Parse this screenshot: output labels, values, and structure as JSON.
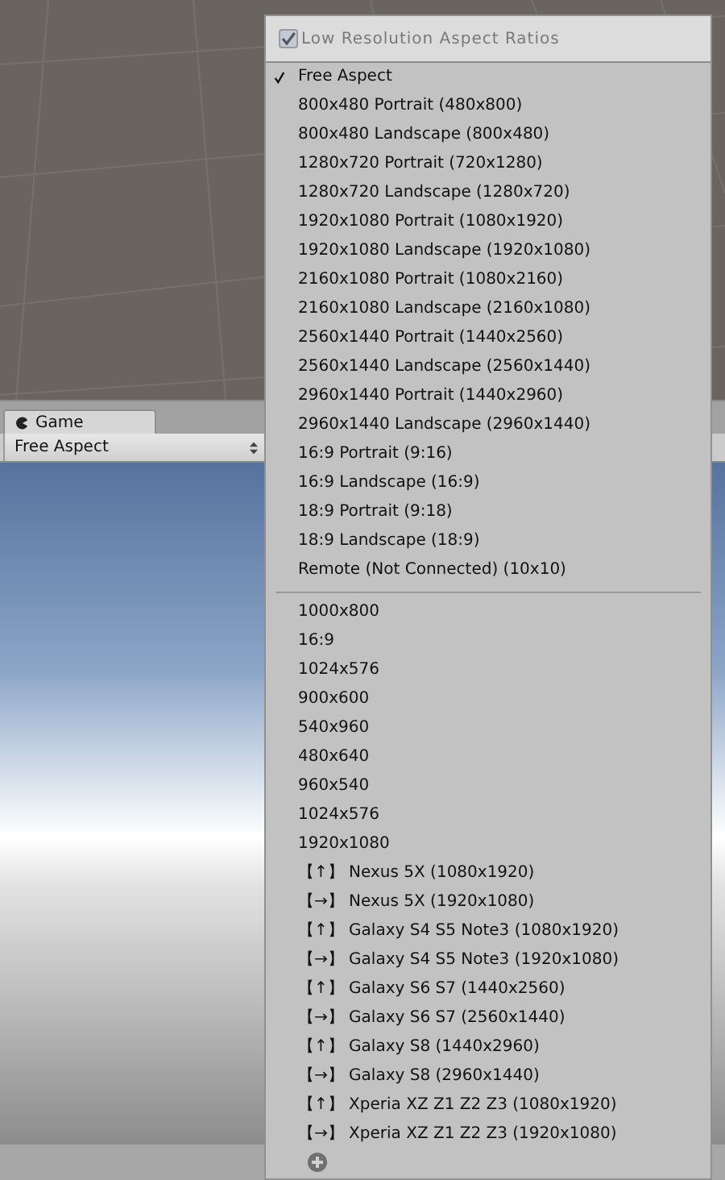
{
  "tabs": [
    {
      "label": "Game",
      "selected": true
    }
  ],
  "toolbar": {
    "aspect": "Free Aspect"
  },
  "menu": {
    "header": {
      "label": "Low Resolution Aspect Ratios",
      "checked": true,
      "disabled": true
    },
    "groups": [
      {
        "items": [
          {
            "label": "Free Aspect",
            "selected": true
          },
          {
            "label": "800x480 Portrait (480x800)",
            "selected": false
          },
          {
            "label": "800x480 Landscape (800x480)",
            "selected": false
          },
          {
            "label": "1280x720 Portrait (720x1280)",
            "selected": false
          },
          {
            "label": "1280x720 Landscape (1280x720)",
            "selected": false
          },
          {
            "label": "1920x1080 Portrait (1080x1920)",
            "selected": false
          },
          {
            "label": "1920x1080 Landscape (1920x1080)",
            "selected": false
          },
          {
            "label": "2160x1080 Portrait (1080x2160)",
            "selected": false
          },
          {
            "label": "2160x1080 Landscape (2160x1080)",
            "selected": false
          },
          {
            "label": "2560x1440 Portrait (1440x2560)",
            "selected": false
          },
          {
            "label": "2560x1440 Landscape (2560x1440)",
            "selected": false
          },
          {
            "label": "2960x1440 Portrait (1440x2960)",
            "selected": false
          },
          {
            "label": "2960x1440 Landscape (2960x1440)",
            "selected": false
          },
          {
            "label": "16:9 Portrait (9:16)",
            "selected": false
          },
          {
            "label": "16:9 Landscape (16:9)",
            "selected": false
          },
          {
            "label": "18:9 Portrait (9:18)",
            "selected": false
          },
          {
            "label": "18:9 Landscape (18:9)",
            "selected": false
          },
          {
            "label": "Remote (Not Connected) (10x10)",
            "selected": false
          }
        ]
      },
      {
        "items": [
          {
            "label": "1000x800",
            "selected": false
          },
          {
            "label": "16:9",
            "selected": false
          },
          {
            "label": "1024x576",
            "selected": false
          },
          {
            "label": "900x600",
            "selected": false
          },
          {
            "label": "540x960",
            "selected": false
          },
          {
            "label": "480x640",
            "selected": false
          },
          {
            "label": "960x540",
            "selected": false
          },
          {
            "label": "1024x576",
            "selected": false
          },
          {
            "label": "1920x1080",
            "selected": false
          },
          {
            "label": "【↑】 Nexus 5X (1080x1920)",
            "selected": false
          },
          {
            "label": "【→】 Nexus 5X (1920x1080)",
            "selected": false
          },
          {
            "label": "【↑】 Galaxy S4 S5 Note3 (1080x1920)",
            "selected": false
          },
          {
            "label": "【→】 Galaxy S4 S5 Note3 (1920x1080)",
            "selected": false
          },
          {
            "label": "【↑】 Galaxy S6 S7 (1440x2560)",
            "selected": false
          },
          {
            "label": "【→】 Galaxy S6 S7 (2560x1440)",
            "selected": false
          },
          {
            "label": "【↑】 Galaxy S8 (1440x2960)",
            "selected": false
          },
          {
            "label": "【→】 Galaxy S8 (2960x1440)",
            "selected": false
          },
          {
            "label": "【↑】 Xperia XZ Z1 Z2 Z3 (1080x1920)",
            "selected": false
          },
          {
            "label": "【→】 Xperia XZ Z1 Z2 Z3 (1920x1080)",
            "selected": false
          }
        ]
      }
    ]
  }
}
